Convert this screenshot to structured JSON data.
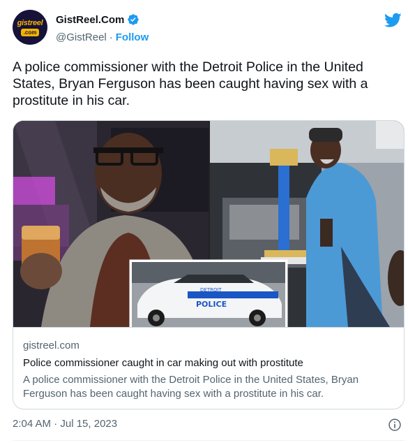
{
  "account": {
    "avatar_brand": "gistreel",
    "avatar_suffix": ".com",
    "display_name": "GistReel.Com",
    "handle": "@GistReel",
    "separator": "·",
    "follow_label": "Follow"
  },
  "tweet": {
    "text": "A police commissioner with the Detroit Police in the United States, Bryan Ferguson has been caught having sex with a prostitute in his car."
  },
  "card": {
    "car_text_1": "DETROIT",
    "car_text_2": "POLICE",
    "domain": "gistreel.com",
    "title": "Police commissioner caught in car making out with prostitute",
    "description": "A police commissioner with the Detroit Police in the United States, Bryan Ferguson has been caught having sex with a prostitute in his car."
  },
  "footer": {
    "timestamp": "2:04 AM · Jul 15, 2023"
  },
  "colors": {
    "accent": "#1d9bf0",
    "muted": "#536471",
    "text": "#0f1419",
    "border": "#cfd9de"
  },
  "icons": [
    "verified-badge-icon",
    "twitter-bird-icon",
    "info-icon"
  ]
}
